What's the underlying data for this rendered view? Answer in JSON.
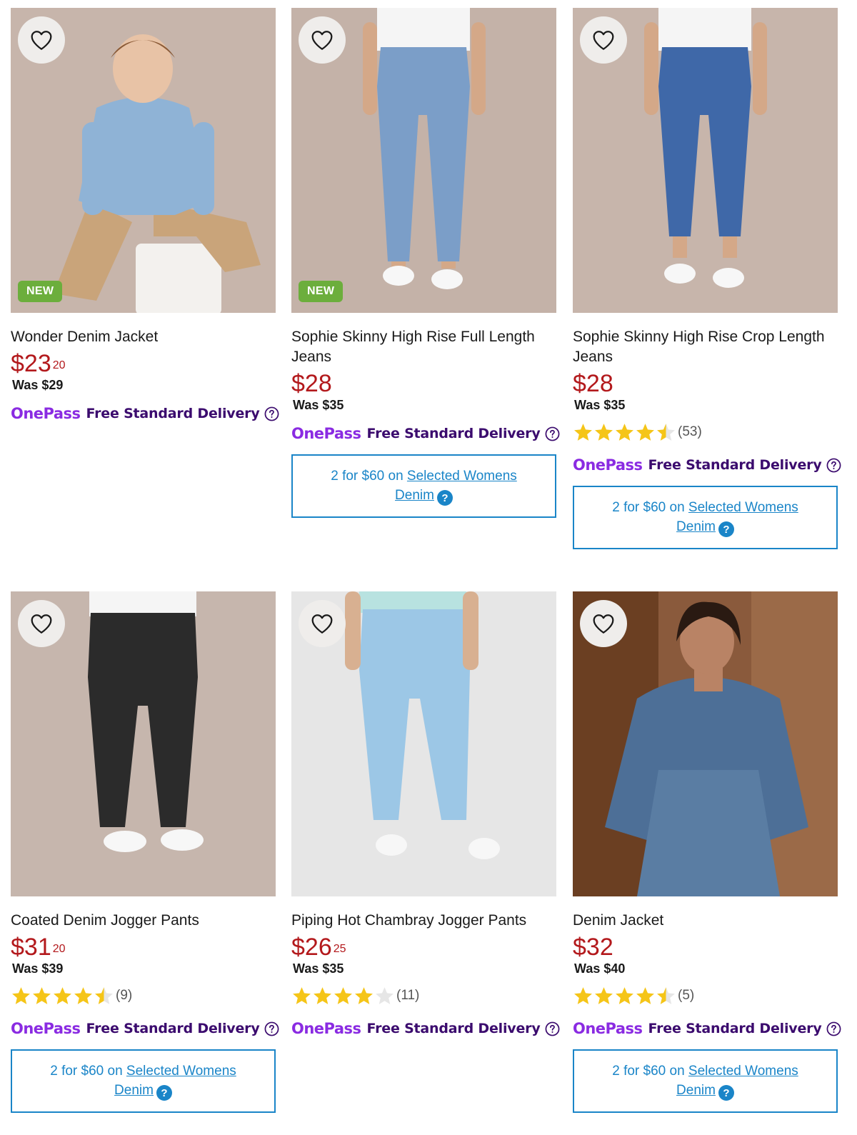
{
  "products": [
    {
      "title": "Wonder Denim Jacket",
      "price_dollars": "$23",
      "price_cents": "20",
      "was": "Was $29",
      "badge": "NEW",
      "rating": null,
      "reviews": null,
      "onepass": "OnePass",
      "delivery": "Free Standard Delivery",
      "promo": null
    },
    {
      "title": "Sophie Skinny High Rise Full Length Jeans",
      "price_dollars": "$28",
      "price_cents": "",
      "was": "Was $35",
      "badge": "NEW",
      "rating": null,
      "reviews": null,
      "onepass": "OnePass",
      "delivery": "Free Standard Delivery",
      "promo": {
        "prefix": "2 for $60 on",
        "link": "Selected Womens Denim",
        "help": "?"
      }
    },
    {
      "title": "Sophie Skinny High Rise Crop Length Jeans",
      "price_dollars": "$28",
      "price_cents": "",
      "was": "Was $35",
      "badge": null,
      "rating": 4.5,
      "reviews": "(53)",
      "onepass": "OnePass",
      "delivery": "Free Standard Delivery",
      "promo": {
        "prefix": "2 for $60 on",
        "link": "Selected Womens Denim",
        "help": "?"
      }
    },
    {
      "title": "Coated Denim Jogger Pants",
      "price_dollars": "$31",
      "price_cents": "20",
      "was": "Was $39",
      "badge": null,
      "rating": 4.5,
      "reviews": "(9)",
      "onepass": "OnePass",
      "delivery": "Free Standard Delivery",
      "promo": {
        "prefix": "2 for $60 on",
        "link": "Selected Womens Denim",
        "help": "?"
      }
    },
    {
      "title": "Piping Hot Chambray Jogger Pants",
      "price_dollars": "$26",
      "price_cents": "25",
      "was": "Was $35",
      "badge": null,
      "rating": 4,
      "reviews": "(11)",
      "onepass": "OnePass",
      "delivery": "Free Standard Delivery",
      "promo": null
    },
    {
      "title": "Denim Jacket",
      "price_dollars": "$32",
      "price_cents": "",
      "was": "Was $40",
      "badge": null,
      "rating": 4.5,
      "reviews": "(5)",
      "onepass": "OnePass",
      "delivery": "Free Standard Delivery",
      "promo": {
        "prefix": "2 for $60 on",
        "link": "Selected Womens Denim",
        "help": "?"
      }
    }
  ],
  "colors": {
    "price": "#b3191c",
    "promo": "#1a85c8",
    "badge": "#6cae3c",
    "star": "#f5c518",
    "onepass": "#8a2be2",
    "delivery": "#3b0b6e"
  },
  "icons": {
    "wishlist": "heart-outline-icon",
    "help": "question-circle-icon",
    "star": "star-icon"
  }
}
